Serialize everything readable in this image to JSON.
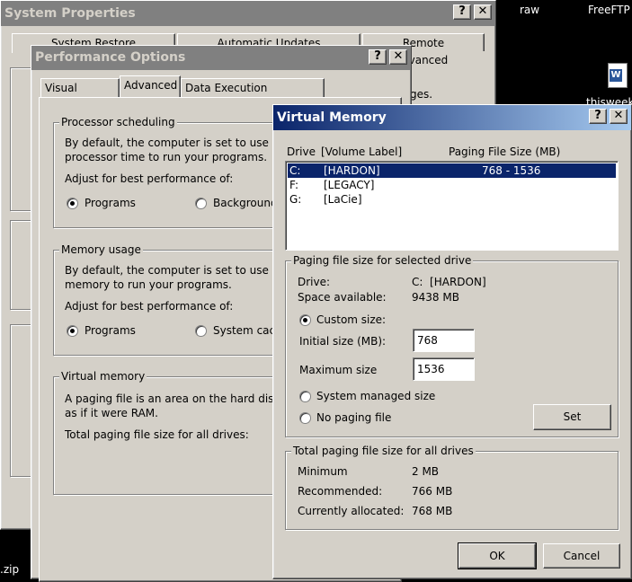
{
  "desktop": {
    "items": [
      "raw",
      "FreeFTP",
      "thisweek",
      ".zip"
    ]
  },
  "system_properties": {
    "title": "System Properties",
    "tabs": [
      "System Restore",
      "Automatic Updates",
      "Remote"
    ],
    "fragments": [
      "Advanced",
      "ges."
    ]
  },
  "perf": {
    "title": "Performance Options",
    "tabs": [
      "Visual Effects",
      "Advanced",
      "Data Execution Prevention"
    ],
    "proc": {
      "legend": "Processor scheduling",
      "desc1": "By default, the computer is set to use a g",
      "desc2": "processor time to run your programs.",
      "adjust": "Adjust for best performance of:",
      "opt1": "Programs",
      "opt2": "Background"
    },
    "mem": {
      "legend": "Memory usage",
      "desc1": "By default, the computer is set to use a g",
      "desc2": "memory to run your programs.",
      "adjust": "Adjust for best performance of:",
      "opt1": "Programs",
      "opt2": "System cach"
    },
    "vm": {
      "legend": "Virtual memory",
      "desc1": "A paging file is an area on the hard disk",
      "desc2": "as if it were RAM.",
      "total": "Total paging file size for all drives:"
    }
  },
  "vmem": {
    "title": "Virtual Memory",
    "headers": {
      "drive": "Drive",
      "label": "[Volume Label]",
      "size": "Paging File Size (MB)"
    },
    "drives": [
      {
        "drive": "C:",
        "label": "[HARDON]",
        "size": "768 - 1536"
      },
      {
        "drive": "F:",
        "label": "[LEGACY]",
        "size": ""
      },
      {
        "drive": "G:",
        "label": "[LaCie]",
        "size": ""
      }
    ],
    "selected": {
      "legend": "Paging file size for selected drive",
      "drive_label": "Drive:",
      "drive_value": "C:  [HARDON]",
      "space_label": "Space available:",
      "space_value": "9438 MB",
      "custom": "Custom size:",
      "initial_label": "Initial size (MB):",
      "initial_value": "768",
      "max_label": "Maximum size",
      "max_value": "1536",
      "system_managed": "System managed size",
      "no_paging": "No paging file",
      "set": "Set"
    },
    "total": {
      "legend": "Total paging file size for all drives",
      "min_label": "Minimum",
      "min_value": "2 MB",
      "rec_label": "Recommended:",
      "rec_value": "766 MB",
      "cur_label": "Currently allocated:",
      "cur_value": "768 MB"
    },
    "ok": "OK",
    "cancel": "Cancel"
  },
  "title_buttons": {
    "help": "?",
    "close": "✕"
  }
}
